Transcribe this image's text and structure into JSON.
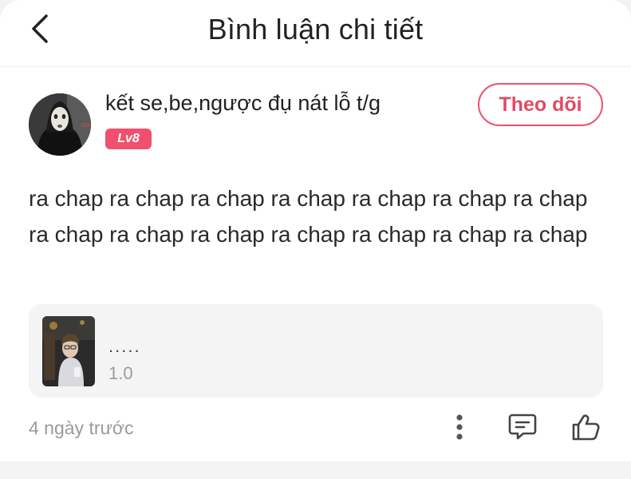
{
  "header": {
    "title": "Bình luận chi tiết",
    "back_icon": "chevron-left-icon"
  },
  "comment": {
    "username": "kết se,be,ngược đụ nát lỗ t/g",
    "level": "Lv8",
    "follow_label": "Theo dõi",
    "text": "ra chap ra chap ra chap ra chap ra chap ra chap ra chap ra chap ra chap ra chap ra chap ra chap ra chap ra chap",
    "time": "4 ngày trước"
  },
  "story_card": {
    "name": ".....",
    "chapter": "1.0"
  },
  "actions": {
    "more_icon": "more-vertical-icon",
    "reply_icon": "comment-icon",
    "like_icon": "thumbs-up-icon"
  },
  "colors": {
    "accent": "#f0506e",
    "muted_text": "#9a9a9a",
    "card_bg": "#f4f4f4"
  }
}
